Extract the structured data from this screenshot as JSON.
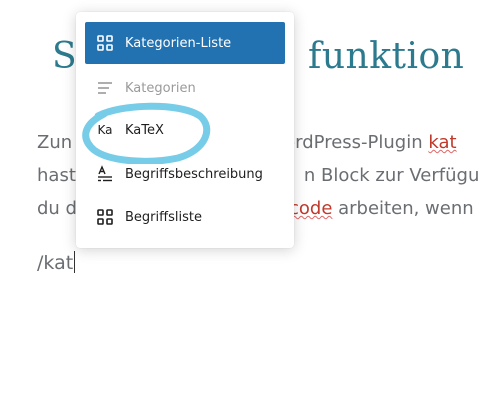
{
  "heading": {
    "left": "S",
    "right": "funktion"
  },
  "paragraph": {
    "line1_start": "Zun",
    "line1_end": "ordPress-Plugin ",
    "line1_link": "kat",
    "line2_start": "hast",
    "line2_end": "n Block zur Verfügu",
    "line3_start": "du d",
    "line3_link": "code",
    "line3_end": " arbeiten, wenn"
  },
  "slash_command": "/kat",
  "menu": {
    "items": [
      {
        "label": "Kategorien-Liste",
        "icon": "grid-icon",
        "active": true
      },
      {
        "label": "Kategorien",
        "icon": "list-icon",
        "active": false
      },
      {
        "label": "KaTeX",
        "icon_text": "Ka",
        "icon": "katex-icon",
        "active": false
      },
      {
        "label": "Begriffsbeschreibung",
        "icon": "definition-icon",
        "active": false
      },
      {
        "label": "Begriffsliste",
        "icon": "grid-icon",
        "active": false
      }
    ]
  },
  "colors": {
    "accent": "#2271b1",
    "heading": "#2c7a8e",
    "highlight_circle": "#5fc3e4"
  }
}
